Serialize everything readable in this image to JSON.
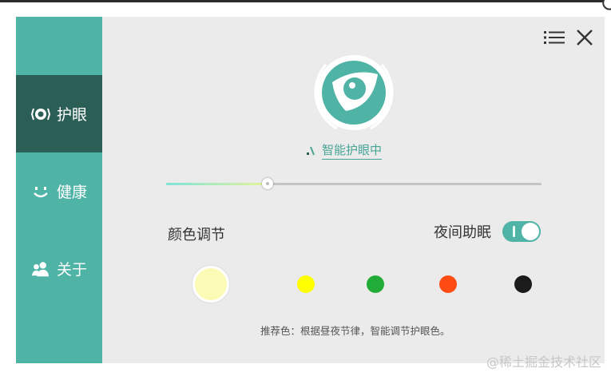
{
  "sidebar": {
    "items": [
      {
        "label": "护眼",
        "icon": "eye-protect-icon",
        "active": true
      },
      {
        "label": "健康",
        "icon": "smile-icon",
        "active": false
      },
      {
        "label": "关于",
        "icon": "users-icon",
        "active": false
      }
    ]
  },
  "header": {
    "menu_icon": "menu-icon",
    "close_icon": "close-icon"
  },
  "main": {
    "status_text": "智能护眼中",
    "brightness": 0.27,
    "color_label": "颜色调节",
    "night_label": "夜间助眠",
    "night_on": true,
    "swatches": [
      {
        "color": "#fcfbb5",
        "selected": true
      },
      {
        "color": "#fefe00",
        "selected": false
      },
      {
        "color": "#21ac38",
        "selected": false
      },
      {
        "color": "#fd4b12",
        "selected": false
      },
      {
        "color": "#1b1b1b",
        "selected": false
      }
    ],
    "hint": "推荐色：根据昼夜节律，智能调节护眼色。"
  },
  "watermark": "@稀土掘金技术社区",
  "colors": {
    "accent": "#4fb3a6",
    "sidebar_active": "#2b5e55",
    "panel_bg": "#ebebeb"
  }
}
